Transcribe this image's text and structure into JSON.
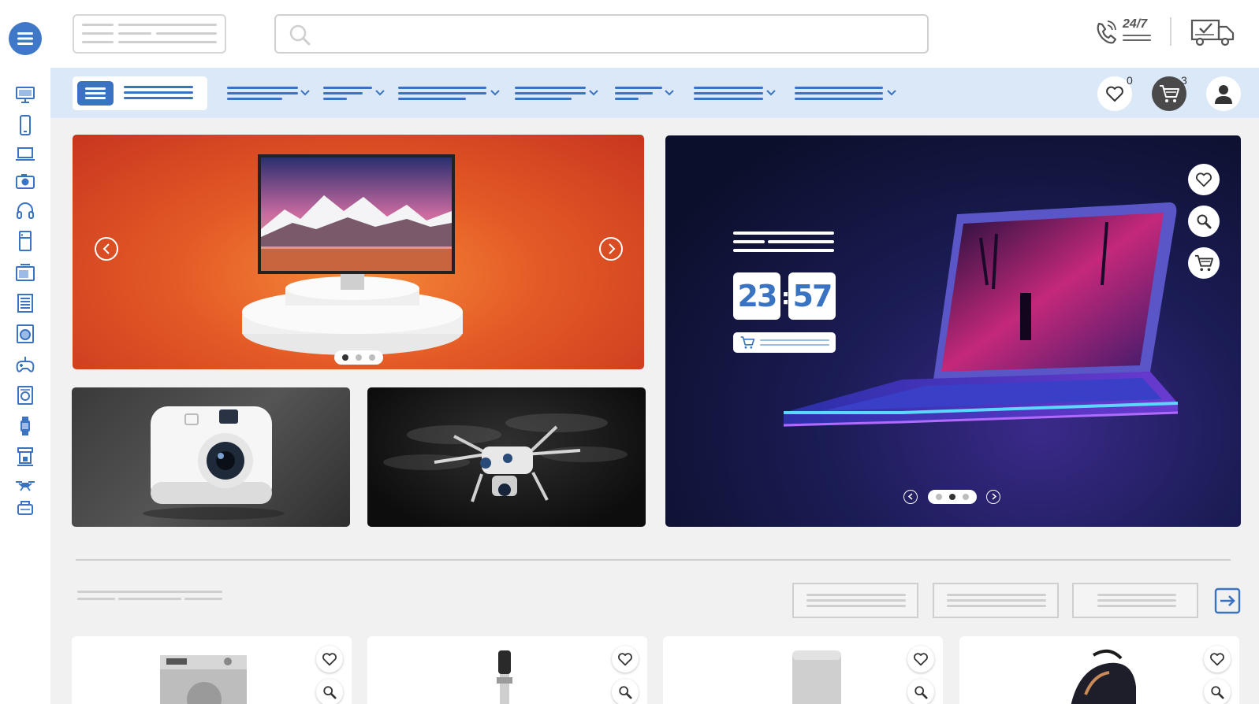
{
  "header": {
    "support_text": "24/7",
    "menu_icon": "hamburger-menu-icon",
    "search_icon": "search-icon",
    "support_icon": "phone-support-icon",
    "delivery_icon": "delivery-truck-icon"
  },
  "sidebar": {
    "icons": [
      "monitor-icon",
      "smartphone-icon",
      "laptop-icon",
      "camera-icon",
      "headphones-icon",
      "refrigerator-icon",
      "microwave-icon",
      "server-rack-icon",
      "washing-machine-icon",
      "gamepad-icon",
      "dishwasher-icon",
      "smartwatch-icon",
      "coffee-machine-icon",
      "drone-icon",
      "robot-vacuum-icon"
    ]
  },
  "navbar": {
    "wishlist_count": "0",
    "cart_count": "3",
    "dropdown_count": 7
  },
  "hero": {
    "tv_slider": {
      "slides": 3,
      "active": 1
    },
    "laptop_slider": {
      "slides": 3,
      "active": 2
    },
    "countdown_hours": "23",
    "countdown_separator": ":",
    "countdown_minutes": "57"
  },
  "products": {
    "cards": [
      {
        "image": "washing-machine"
      },
      {
        "image": "immersion-blender"
      },
      {
        "image": "air-purifier"
      },
      {
        "image": "steam-iron"
      }
    ]
  },
  "colors": {
    "accent": "#3a73c2",
    "nav_bg": "#dbe8f8",
    "page_bg": "#f1f1f1"
  }
}
